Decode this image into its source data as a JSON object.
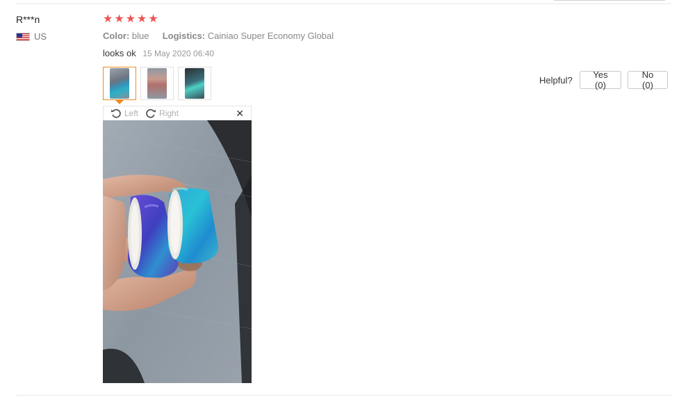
{
  "review": {
    "user": "R***n",
    "country": "US",
    "rating": 5,
    "stars": [
      "★",
      "★",
      "★",
      "★",
      "★"
    ],
    "star_color": "#ef5350",
    "color_label": "Color:",
    "color_value": "blue",
    "logistics_label": "Logistics:",
    "logistics_value": "Cainiao Super Economy Global",
    "text": "looks ok",
    "date": "15 May 2020 06:40",
    "thumbnails": [
      {
        "alt": "photo 1",
        "selected": true
      },
      {
        "alt": "photo 2",
        "selected": false
      },
      {
        "alt": "photo 3",
        "selected": false
      }
    ]
  },
  "viewer": {
    "rotate_left_label": "Left",
    "rotate_right_label": "Right",
    "close_symbol": "✕",
    "rotate_left_icon": "rotate-left-icon",
    "rotate_right_icon": "rotate-right-icon",
    "close_icon": "close-icon"
  },
  "feedback": {
    "helpful_label": "Helpful?",
    "yes_label": "Yes (0)",
    "no_label": "No (0)"
  },
  "colors": {
    "accent": "#f08a24",
    "muted_text": "#888888"
  }
}
